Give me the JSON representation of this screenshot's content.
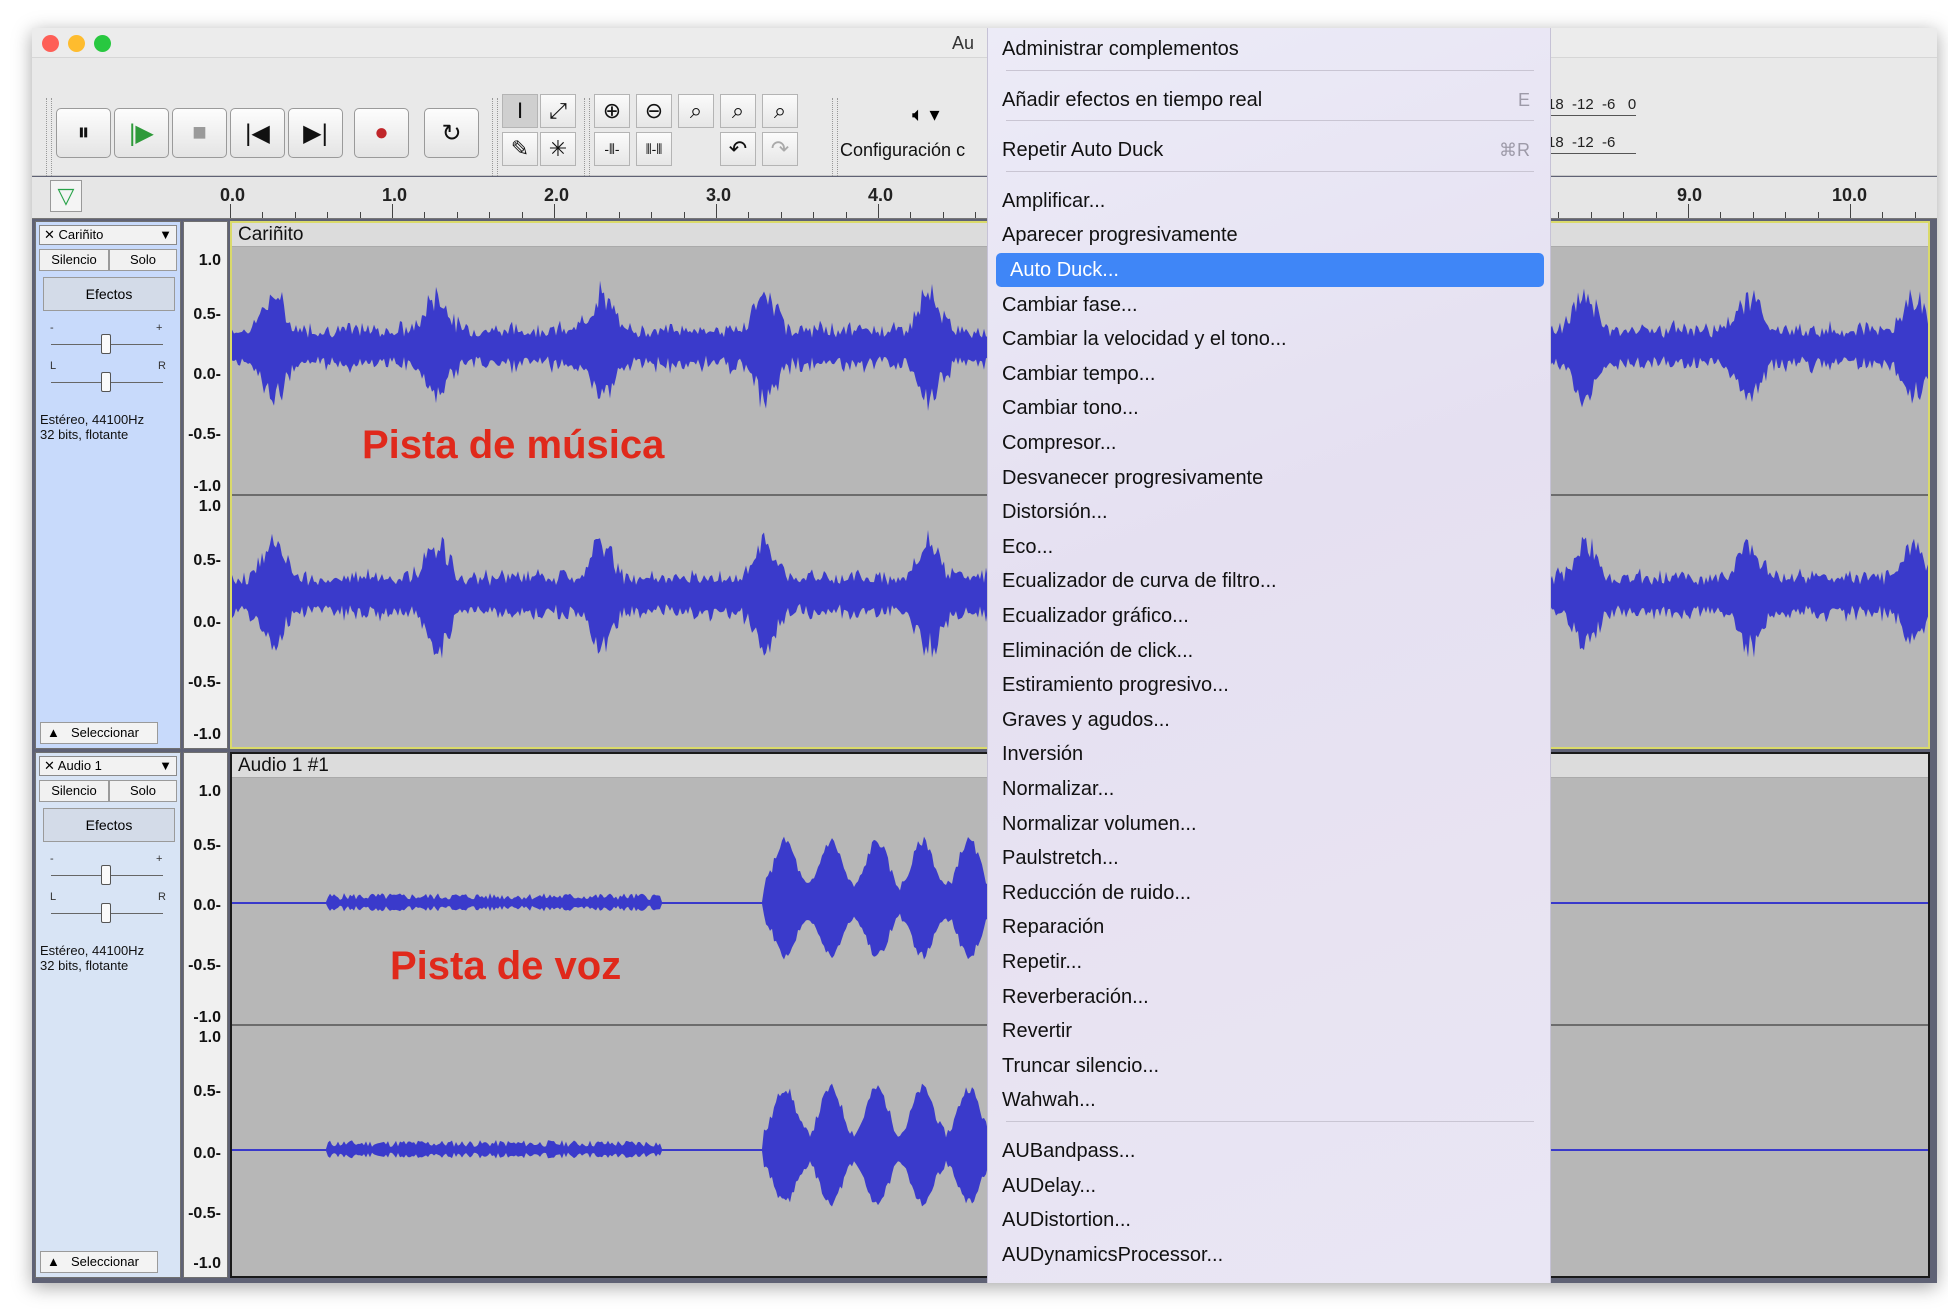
{
  "window": {
    "title": "Au",
    "lights": {
      "close": "#fe5f57",
      "minimize": "#febc2e",
      "zoom": "#28c840"
    }
  },
  "toolbar": {
    "transport": [
      "⏸",
      "|▶",
      "■",
      "|◀",
      "▶|",
      "●",
      "↻"
    ],
    "config_label": "Configuración c",
    "speaker": "🔈︎ ▾",
    "meter_top": "-18  -12  -6   0",
    "meter_bottom": "-18  -12  -6"
  },
  "ruler": {
    "labels": [
      "0.0",
      "1.0",
      "2.0",
      "3.0",
      "4.0",
      "9.0",
      "10.0"
    ]
  },
  "tracks": [
    {
      "name": "Cariñito",
      "mute": "Silencio",
      "solo": "Solo",
      "effects": "Efectos",
      "gain_minus": "-",
      "gain_plus": "+",
      "pan_left": "L",
      "pan_right": "R",
      "format_line1": "Estéreo, 44100Hz",
      "format_line2": "32 bits, flotante",
      "select": "Seleccionar",
      "clip_name": "Cariñito",
      "scale": [
        "1.0",
        "0.5-",
        "0.0-",
        "-0.5-",
        "-1.0"
      ],
      "scale2": [
        "1.0",
        "0.5-",
        "0.0-",
        "-0.5-",
        "-1.0"
      ],
      "annotation": "Pista de música"
    },
    {
      "name": "Audio 1",
      "mute": "Silencio",
      "solo": "Solo",
      "effects": "Efectos",
      "gain_minus": "-",
      "gain_plus": "+",
      "pan_left": "L",
      "pan_right": "R",
      "format_line1": "Estéreo, 44100Hz",
      "format_line2": "32 bits, flotante",
      "select": "Seleccionar",
      "clip_name": "Audio 1 #1",
      "scale": [
        "1.0",
        "0.5-",
        "0.0-",
        "-0.5-",
        "-1.0"
      ],
      "scale2": [
        "1.0",
        "0.5-",
        "0.0-",
        "-0.5-",
        "-1.0"
      ],
      "annotation": "Pista de voz"
    }
  ],
  "menu": {
    "items": [
      {
        "label": "Administrar complementos"
      },
      {
        "label": "Añadir efectos en tiempo real",
        "shortcut": "E"
      },
      {
        "label": "Repetir Auto Duck",
        "shortcut": "⌘R"
      },
      {
        "label": "Amplificar..."
      },
      {
        "label": "Aparecer progresivamente"
      },
      {
        "label": "Auto Duck..."
      },
      {
        "label": "Cambiar fase..."
      },
      {
        "label": "Cambiar la velocidad y el tono..."
      },
      {
        "label": "Cambiar tempo..."
      },
      {
        "label": "Cambiar tono..."
      },
      {
        "label": "Compresor..."
      },
      {
        "label": "Desvanecer progresivamente"
      },
      {
        "label": "Distorsión..."
      },
      {
        "label": "Eco..."
      },
      {
        "label": "Ecualizador de curva de filtro..."
      },
      {
        "label": "Ecualizador gráfico..."
      },
      {
        "label": "Eliminación de click..."
      },
      {
        "label": "Estiramiento progresivo..."
      },
      {
        "label": "Graves y agudos..."
      },
      {
        "label": "Inversión"
      },
      {
        "label": "Normalizar..."
      },
      {
        "label": "Normalizar volumen..."
      },
      {
        "label": "Paulstretch..."
      },
      {
        "label": "Reducción de ruido..."
      },
      {
        "label": "Reparación"
      },
      {
        "label": "Repetir..."
      },
      {
        "label": "Reverberación..."
      },
      {
        "label": "Revertir"
      },
      {
        "label": "Truncar silencio..."
      },
      {
        "label": "Wahwah..."
      },
      {
        "label": "AUBandpass..."
      },
      {
        "label": "AUDelay..."
      },
      {
        "label": "AUDistortion..."
      },
      {
        "label": "AUDynamicsProcessor..."
      }
    ],
    "highlight_color": "#3f86f7"
  },
  "colors": {
    "waveform": "#3a3acb",
    "annotation": "#e0291b",
    "selected_border": "#dada6a"
  }
}
